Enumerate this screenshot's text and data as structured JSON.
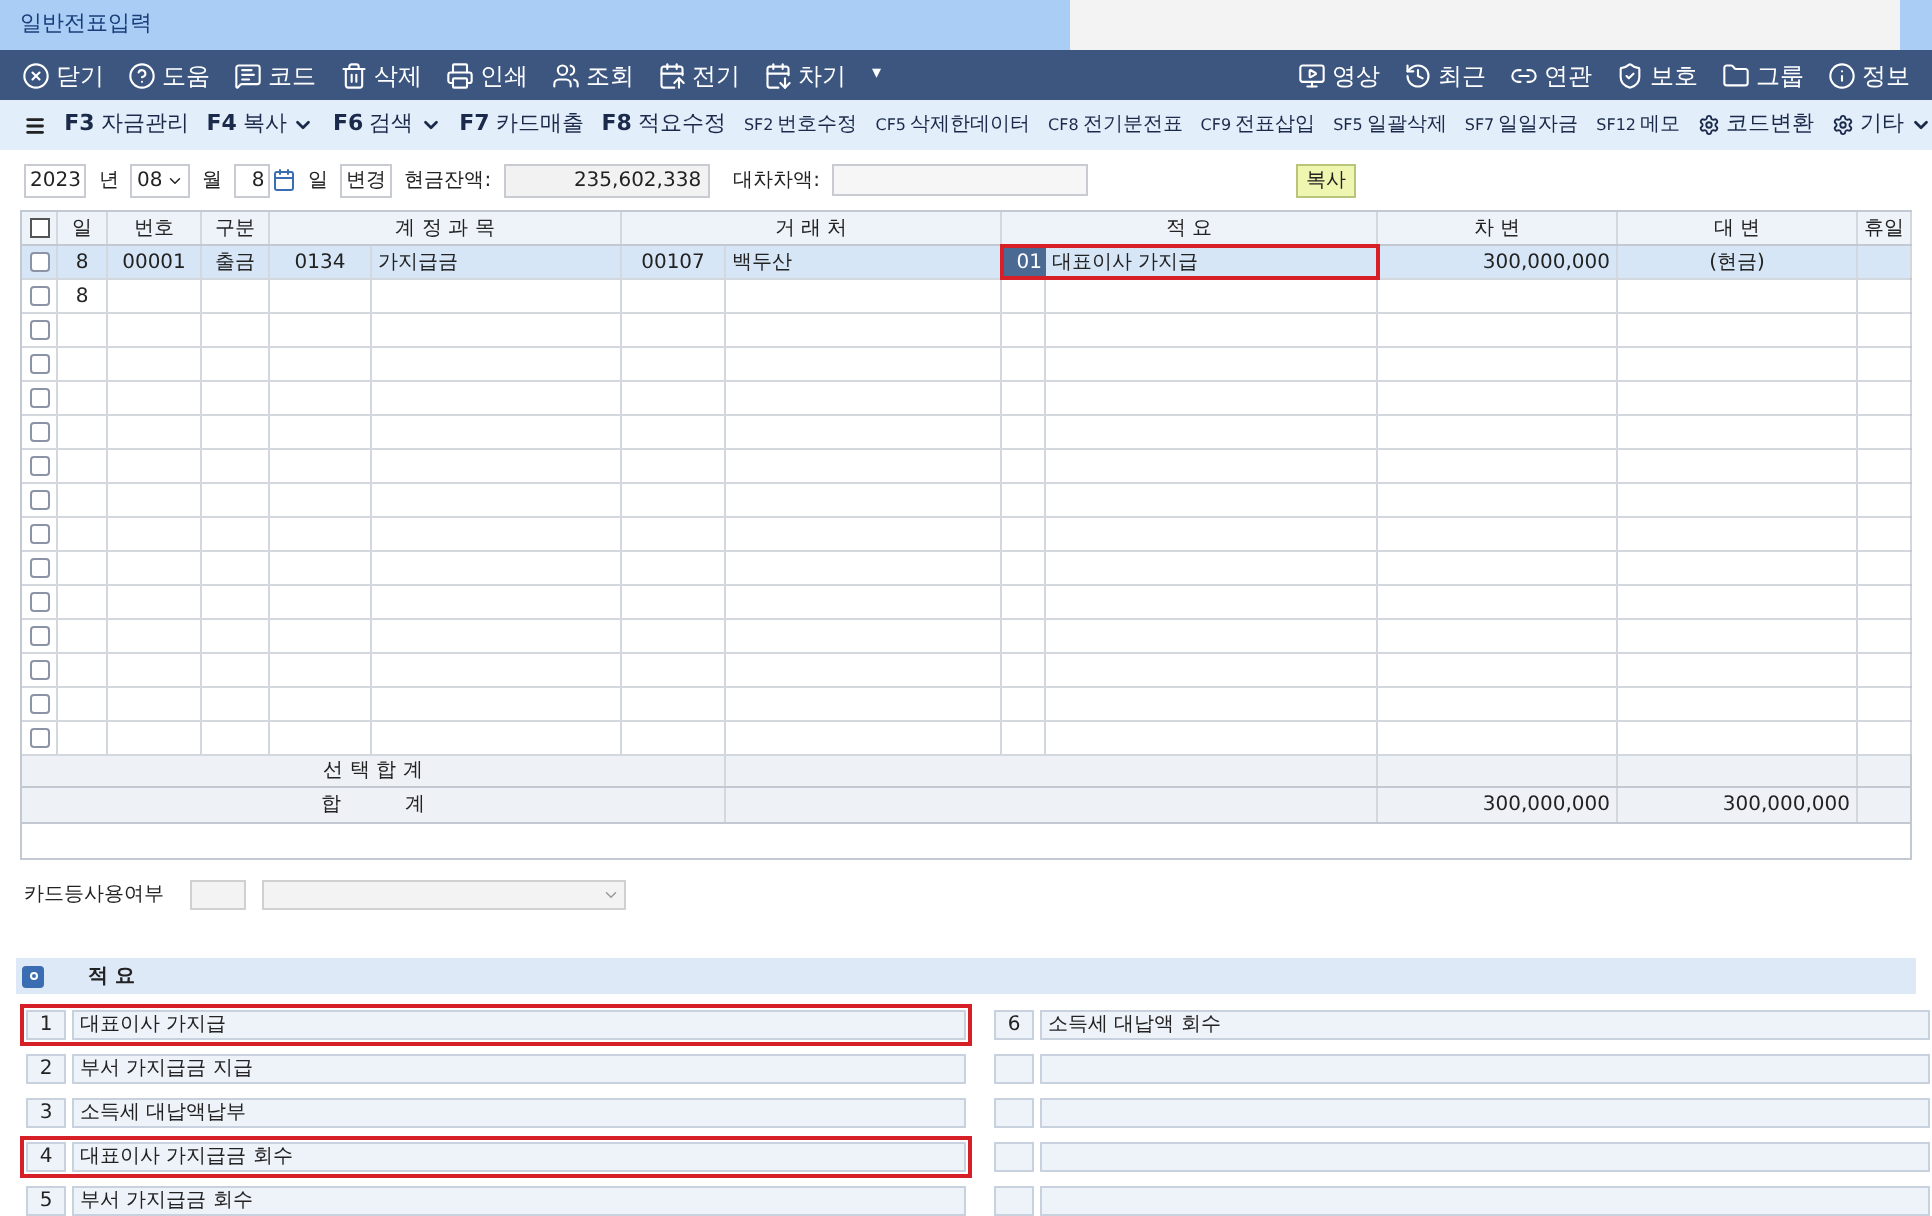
{
  "window": {
    "title": "일반전표입력"
  },
  "toolbar_left": [
    {
      "kind": "close",
      "label": "닫기"
    },
    {
      "kind": "help",
      "label": "도움"
    },
    {
      "kind": "code",
      "label": "코드"
    },
    {
      "kind": "delete",
      "label": "삭제"
    },
    {
      "kind": "print",
      "label": "인쇄"
    },
    {
      "kind": "search",
      "label": "조회"
    },
    {
      "kind": "prev",
      "label": "전기"
    },
    {
      "kind": "next",
      "label": "차기"
    }
  ],
  "toolbar_more": "▾",
  "toolbar_right": [
    {
      "kind": "video",
      "label": "영상"
    },
    {
      "kind": "recent",
      "label": "최근"
    },
    {
      "kind": "link",
      "label": "연관"
    },
    {
      "kind": "protect",
      "label": "보호"
    },
    {
      "kind": "group",
      "label": "그룹"
    },
    {
      "kind": "info",
      "label": "정보"
    }
  ],
  "function_keys": [
    {
      "key": "F3",
      "label": "자금관리",
      "dropdown": false,
      "kind": "fkey"
    },
    {
      "key": "F4",
      "label": "복사",
      "dropdown": true,
      "kind": "fkey"
    },
    {
      "key": "F6",
      "label": "검색",
      "dropdown": true,
      "kind": "fkey"
    },
    {
      "key": "F7",
      "label": "카드매출",
      "dropdown": false,
      "kind": "fkey"
    },
    {
      "key": "F8",
      "label": "적요수정",
      "dropdown": false,
      "kind": "fkey"
    },
    {
      "key": "SF2",
      "label": "번호수정",
      "dropdown": false,
      "kind": "small"
    },
    {
      "key": "CF5",
      "label": "삭제한데이터",
      "dropdown": false,
      "kind": "small"
    },
    {
      "key": "CF8",
      "label": "전기분전표",
      "dropdown": false,
      "kind": "small"
    },
    {
      "key": "CF9",
      "label": "전표삽입",
      "dropdown": false,
      "kind": "small"
    },
    {
      "key": "SF5",
      "label": "일괄삭제",
      "dropdown": false,
      "kind": "small"
    },
    {
      "key": "SF7",
      "label": "일일자금",
      "dropdown": false,
      "kind": "small"
    },
    {
      "key": "SF12",
      "label": "메모",
      "dropdown": false,
      "kind": "small"
    },
    {
      "label": "코드변환",
      "dropdown": false,
      "kind": "badge"
    },
    {
      "label": "기타",
      "dropdown": true,
      "kind": "badge"
    }
  ],
  "date_bar": {
    "year": "2023",
    "year_label": "년",
    "month": "08",
    "month_label": "월",
    "day": "8",
    "day_label": "일",
    "change_button": "변경",
    "cash_label": "현금잔액:",
    "cash_value": "235,602,338",
    "diff_label": "대차차액:",
    "copy_button": "복사"
  },
  "table": {
    "select_all_checked": false,
    "columns": [
      "일",
      "번호",
      "구분",
      "계 정 과 목",
      "거 래 처",
      "적 요",
      "차 변",
      "대 변",
      "휴일"
    ],
    "rows": [
      {
        "checked": false,
        "selected": true,
        "day": "8",
        "number": "00001",
        "type": "출금",
        "account_code": "0134",
        "account": "가지급금",
        "partner_code": "00107",
        "partner": "백두산",
        "memo_code": "01",
        "memo": "대표이사 가지급",
        "memo_highlighted": true,
        "debit": "300,000,000",
        "credit": "(현금)"
      },
      {
        "checked": false,
        "selected": false,
        "day": "8"
      },
      {
        "checked": false,
        "selected": false
      },
      {
        "checked": false,
        "selected": false
      },
      {
        "checked": false,
        "selected": false
      },
      {
        "checked": false,
        "selected": false
      },
      {
        "checked": false,
        "selected": false
      },
      {
        "checked": false,
        "selected": false
      },
      {
        "checked": false,
        "selected": false
      },
      {
        "checked": false,
        "selected": false
      },
      {
        "checked": false,
        "selected": false
      },
      {
        "checked": false,
        "selected": false
      },
      {
        "checked": false,
        "selected": false
      },
      {
        "checked": false,
        "selected": false
      },
      {
        "checked": false,
        "selected": false
      }
    ],
    "selected_total_label": "선 택 합 계",
    "total_label": "합          계",
    "total_debit": "300,000,000",
    "total_credit": "300,000,000"
  },
  "card_usage": {
    "label": "카드등사용여부"
  },
  "memo_panel": {
    "title": "적 요",
    "items": [
      {
        "number": "1",
        "text": "대표이사 가지급",
        "highlighted": true
      },
      {
        "number": "6",
        "text": "소득세 대납액 회수",
        "highlighted": false
      },
      {
        "number": "2",
        "text": "부서 가지급금 지급",
        "highlighted": false
      },
      {
        "highlighted": false
      },
      {
        "number": "3",
        "text": "소득세 대납액납부",
        "highlighted": false
      },
      {
        "highlighted": false
      },
      {
        "number": "4",
        "text": "대표이사 가지급금 회수",
        "highlighted": true
      },
      {
        "highlighted": false
      },
      {
        "number": "5",
        "text": "부서 가지급금 회수",
        "highlighted": false
      },
      {
        "highlighted": false
      }
    ]
  }
}
